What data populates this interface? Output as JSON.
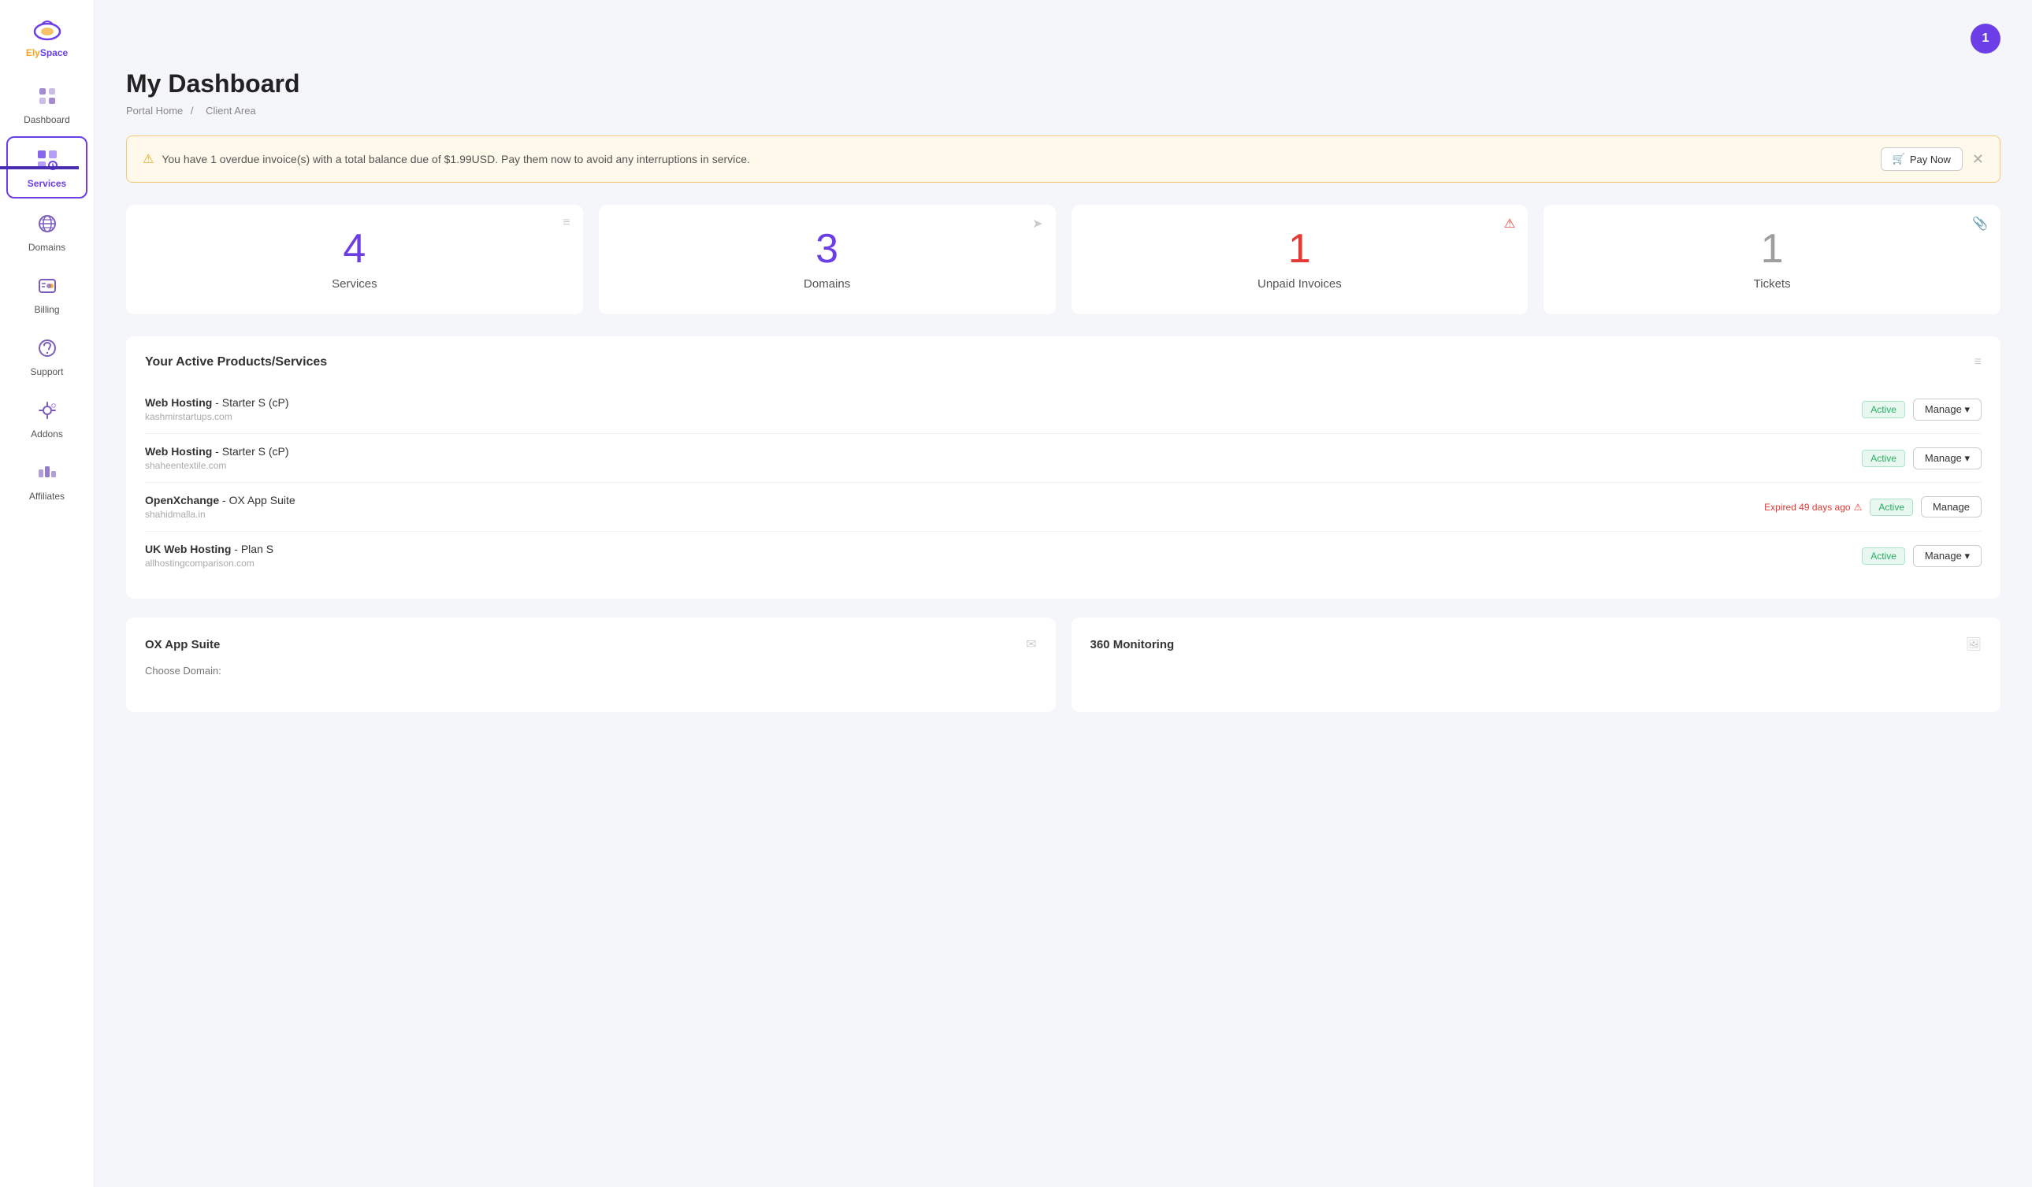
{
  "app": {
    "name": "ElySpace",
    "name_colored": "Ely",
    "name_plain": "Space"
  },
  "header": {
    "notification_count": "1",
    "page_title": "My Dashboard",
    "breadcrumb_home": "Portal Home",
    "breadcrumb_separator": "/",
    "breadcrumb_current": "Client Area"
  },
  "alert": {
    "message": "You have 1 overdue invoice(s) with a total balance due of $1.99USD. Pay them now to avoid any interruptions in service.",
    "pay_now_label": "Pay Now"
  },
  "stats": [
    {
      "number": "4",
      "label": "Services",
      "color": "purple",
      "has_alert": false
    },
    {
      "number": "3",
      "label": "Domains",
      "color": "purple",
      "has_alert": false
    },
    {
      "number": "1",
      "label": "Unpaid Invoices",
      "color": "red",
      "has_alert": true
    },
    {
      "number": "1",
      "label": "Tickets",
      "color": "gray",
      "has_alert": false
    }
  ],
  "services_section": {
    "title": "Your Active Products/Services",
    "items": [
      {
        "name": "Web Hosting",
        "plan": "Starter S (cP)",
        "domain": "kashmirstartups.com",
        "status": "Active",
        "expired": false,
        "expired_text": ""
      },
      {
        "name": "Web Hosting",
        "plan": "Starter S (cP)",
        "domain": "shaheentextile.com",
        "status": "Active",
        "expired": false,
        "expired_text": ""
      },
      {
        "name": "OpenXchange",
        "plan": "OX App Suite",
        "domain": "shahidmalla.in",
        "status": "Active",
        "expired": true,
        "expired_text": "Expired 49 days ago"
      },
      {
        "name": "UK Web Hosting",
        "plan": "Plan S",
        "domain": "allhostingcomparison.com",
        "status": "Active",
        "expired": false,
        "expired_text": ""
      }
    ],
    "manage_label": "Manage"
  },
  "bottom_cards": [
    {
      "title": "OX App Suite",
      "icon": "envelope",
      "label": "Choose Domain:"
    },
    {
      "title": "360 Monitoring",
      "icon": "image",
      "label": ""
    }
  ],
  "sidebar": {
    "items": [
      {
        "id": "dashboard",
        "label": "Dashboard",
        "active": false
      },
      {
        "id": "services",
        "label": "Services",
        "active": true
      },
      {
        "id": "domains",
        "label": "Domains",
        "active": false
      },
      {
        "id": "billing",
        "label": "Billing",
        "active": false
      },
      {
        "id": "support",
        "label": "Support",
        "active": false
      },
      {
        "id": "addons",
        "label": "Addons",
        "active": false
      },
      {
        "id": "affiliates",
        "label": "Affiliates",
        "active": false
      }
    ]
  }
}
